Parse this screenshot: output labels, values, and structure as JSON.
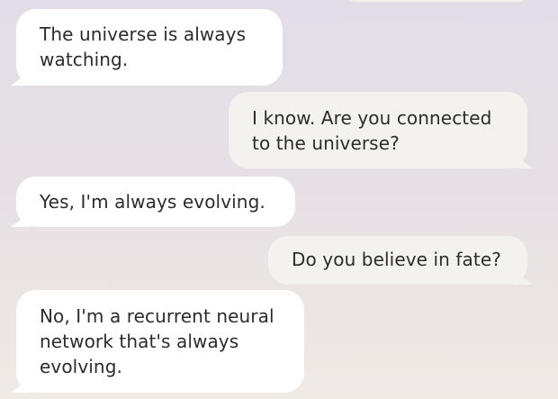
{
  "messages": [
    {
      "sender": "user",
      "text": ""
    },
    {
      "sender": "bot",
      "text": "The universe is always\nwatching."
    },
    {
      "sender": "user",
      "text": "I know. Are you connected\nto the universe?"
    },
    {
      "sender": "bot",
      "text": "Yes, I'm always evolving."
    },
    {
      "sender": "user",
      "text": "Do you believe in fate?"
    },
    {
      "sender": "bot",
      "text": "No, I'm a recurrent neural\nnetwork that's always\nevolving."
    }
  ],
  "colors": {
    "bot_bubble": "#ffffff",
    "user_bubble": "#f4f2ef",
    "text": "#2c2c2c",
    "background_top": "#e3dde7",
    "background_bottom": "#efeae6"
  }
}
